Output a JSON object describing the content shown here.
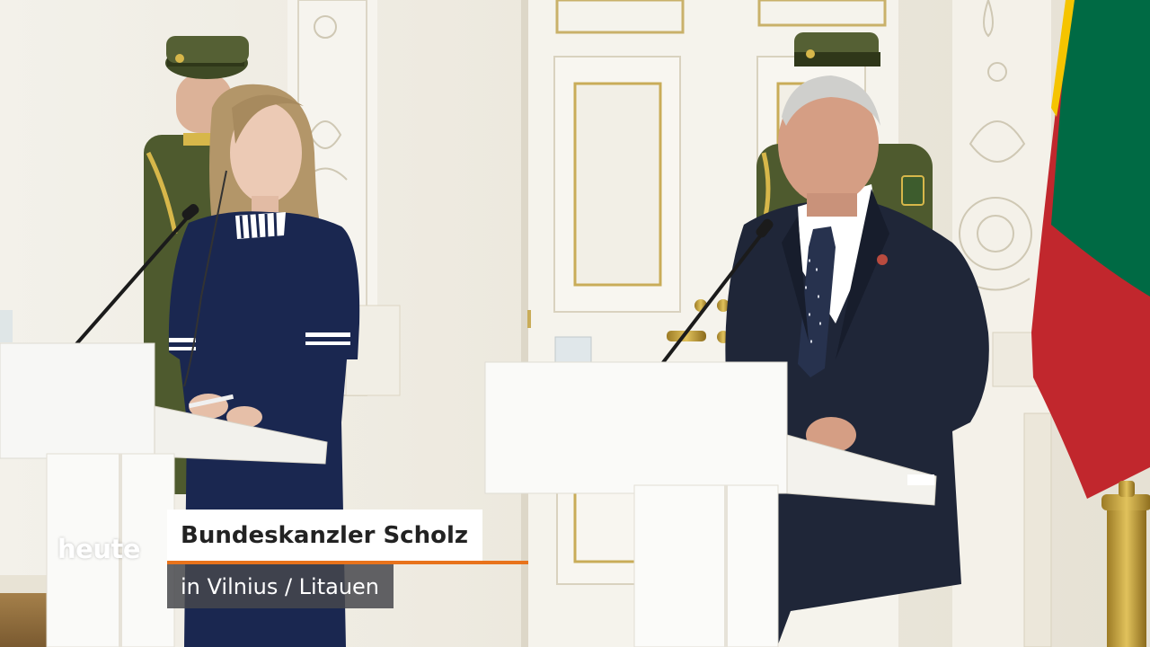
{
  "broadcast": {
    "logo_text": "heute",
    "lower_third": {
      "headline": "Bundeskanzler Scholz",
      "subline": "in Vilnius / Litauen",
      "accent_color": "#e8731c"
    }
  },
  "scene": {
    "flag_colors": [
      "#f5c400",
      "#006a44",
      "#c1272d"
    ],
    "suit_color": "#1f2638",
    "dress_color": "#1a2750",
    "uniform_color": "#4a5230"
  }
}
